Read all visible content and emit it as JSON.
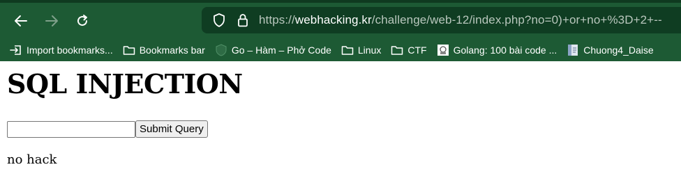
{
  "browser": {
    "nav": {
      "back_icon": "arrow-left-icon",
      "forward_icon": "arrow-right-icon",
      "reload_icon": "reload-icon"
    },
    "address": {
      "shield_icon": "shield-icon",
      "lock_icon": "lock-icon",
      "scheme": "https://",
      "host": "webhacking.kr",
      "path": "/challenge/web-12/index.php?no=0)+or+no+%3D+2+--"
    },
    "bookmarks": [
      {
        "icon": "import-icon",
        "label": "Import bookmarks..."
      },
      {
        "icon": "folder-icon",
        "label": "Bookmarks bar"
      },
      {
        "icon": "site-icon",
        "label": "Go – Hàm – Phở Code"
      },
      {
        "icon": "folder-icon",
        "label": "Linux"
      },
      {
        "icon": "folder-icon",
        "label": "CTF"
      },
      {
        "icon": "site-icon",
        "label": "Golang: 100 bài code ..."
      },
      {
        "icon": "document-icon",
        "label": "Chuong4_Daise"
      }
    ]
  },
  "page": {
    "title": "SQL INJECTION",
    "input_value": "",
    "submit_label": "Submit Query",
    "result_text": "no hack"
  },
  "colors": {
    "toolbar_bg": "#1d5a34",
    "urlbar_bg": "#0f3d22"
  }
}
